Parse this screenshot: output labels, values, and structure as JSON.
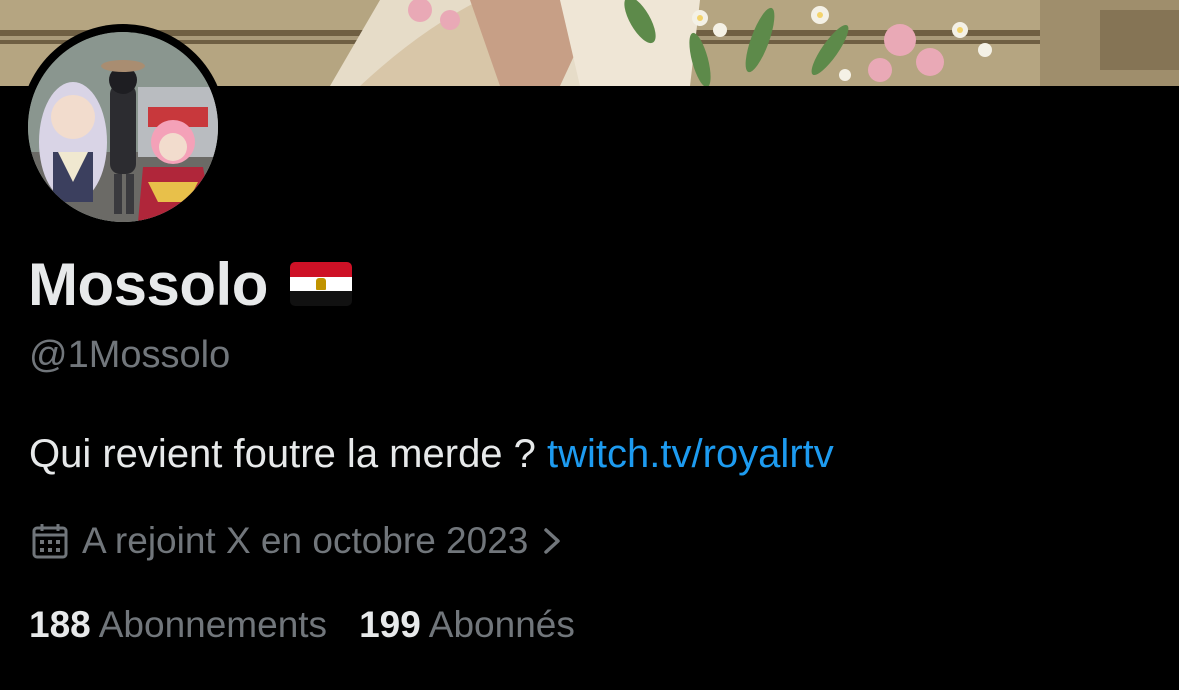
{
  "profile": {
    "display_name": "Mossolo",
    "flag_icon": "egypt-flag-icon",
    "handle": "@1Mossolo",
    "bio_text": "Qui revient foutre la merde ? ",
    "bio_link": "twitch.tv/royalrtv",
    "joined": "A rejoint X en octobre 2023",
    "following_count": "188",
    "following_label": "Abonnements",
    "followers_count": "199",
    "followers_label": "Abonnés"
  },
  "colors": {
    "background": "#000000",
    "primary_text": "#e7e9ea",
    "secondary_text": "#71767b",
    "link": "#1d9bf0"
  },
  "icons": [
    "calendar-icon",
    "chevron-right-icon",
    "egypt-flag-icon"
  ]
}
